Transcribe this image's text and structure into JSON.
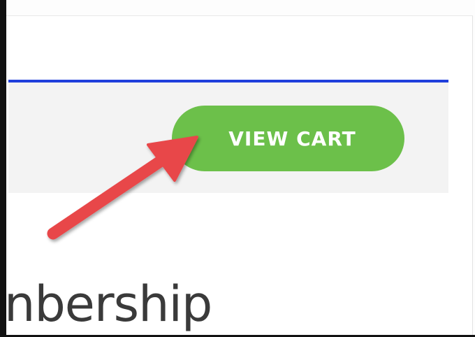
{
  "cart_bar": {
    "button_label": "VIEW CART"
  },
  "content": {
    "heading_fragment": "nbership"
  },
  "annotation": {
    "arrow_icon": "red-pointer-arrow-icon"
  },
  "colors": {
    "accent_line": "#1f3fdc",
    "button_bg": "#6cc04a",
    "arrow": "#e8474a"
  }
}
